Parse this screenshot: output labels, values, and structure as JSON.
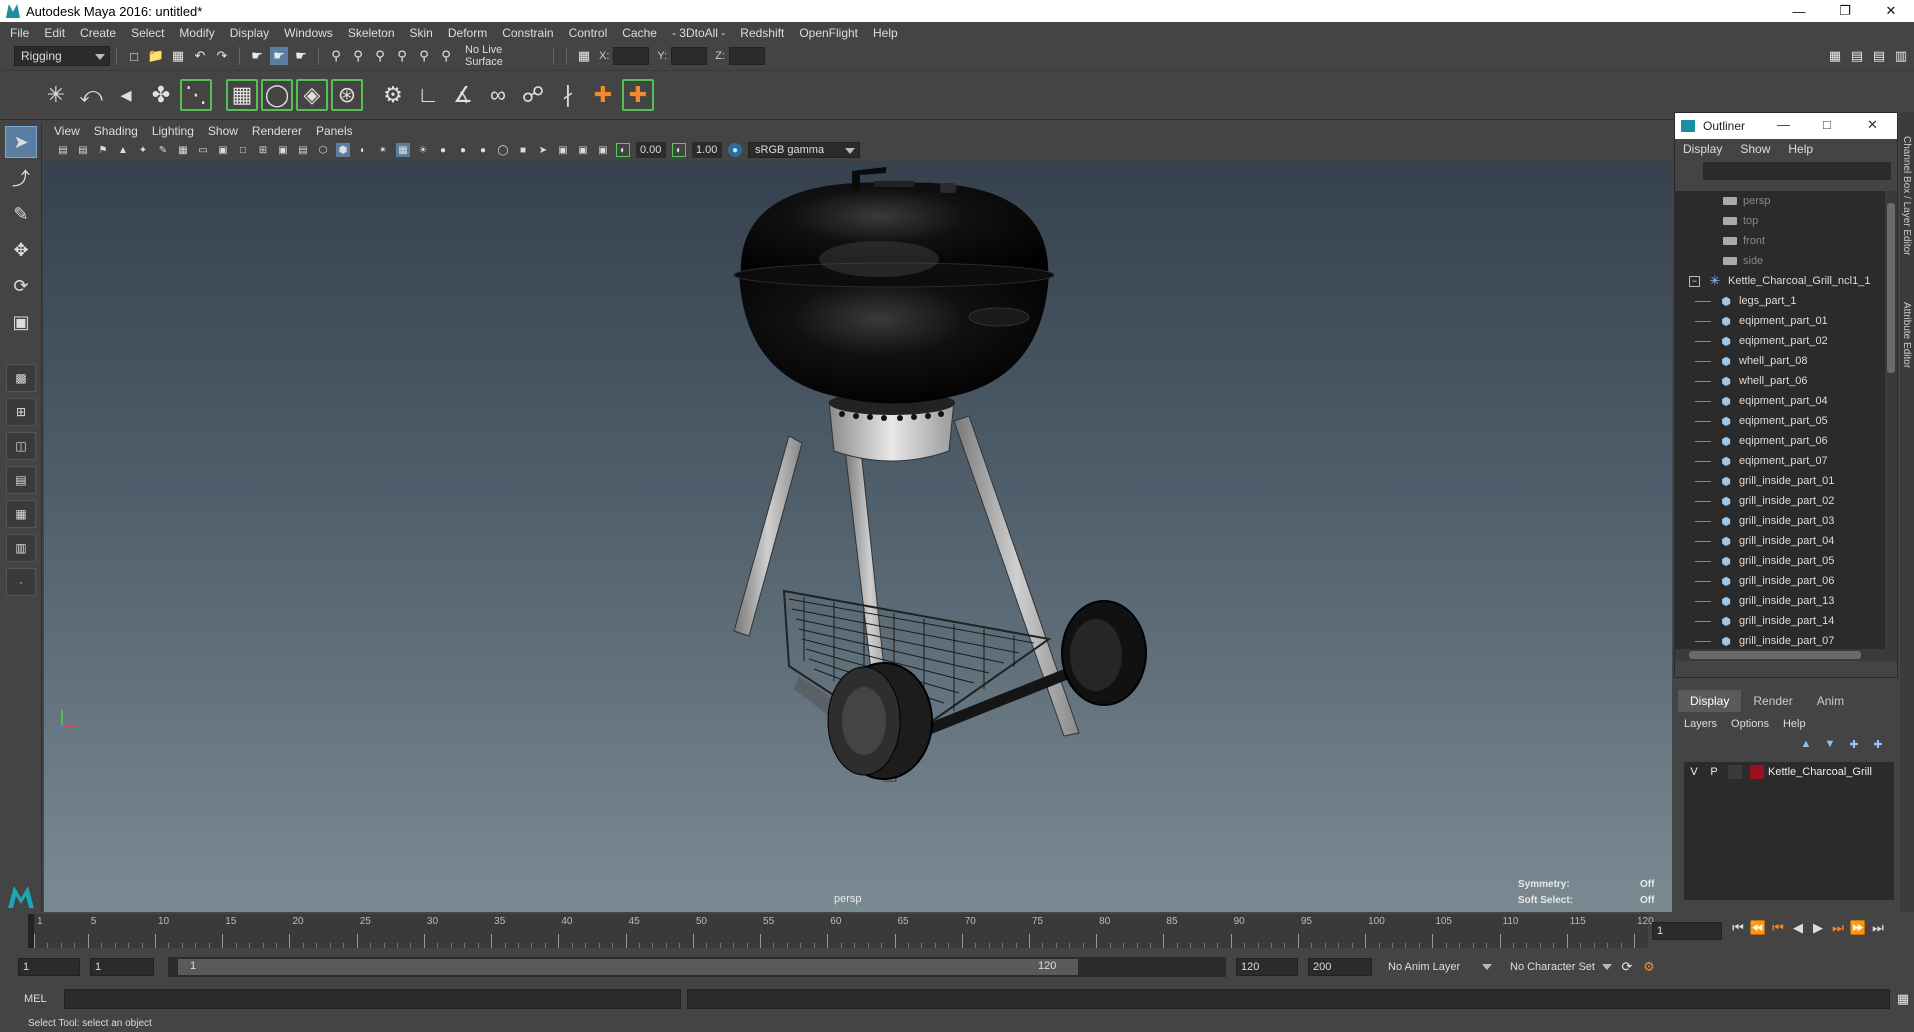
{
  "window": {
    "title": "Autodesk Maya 2016: untitled*"
  },
  "menubar": [
    "File",
    "Edit",
    "Create",
    "Select",
    "Modify",
    "Display",
    "Windows",
    "Skeleton",
    "Skin",
    "Deform",
    "Constrain",
    "Control",
    "Cache",
    "- 3DtoAll -",
    "Redshift",
    "OpenFlight",
    "Help"
  ],
  "statusline": {
    "menuset": "Rigging",
    "live_surface": "No Live Surface",
    "x_label": "X:",
    "y_label": "Y:",
    "z_label": "Z:"
  },
  "viewport": {
    "menu": [
      "View",
      "Shading",
      "Lighting",
      "Show",
      "Renderer",
      "Panels"
    ],
    "exposure": "0.00",
    "gamma": "1.00",
    "colorspace": "sRGB gamma",
    "camera": "persp",
    "hud": {
      "symmetry_label": "Symmetry:",
      "symmetry_value": "Off",
      "softselect_label": "Soft Select:",
      "softselect_value": "Off"
    }
  },
  "outliner": {
    "title": "Outliner",
    "menu": [
      "Display",
      "Show",
      "Help"
    ],
    "cameras": [
      "persp",
      "top",
      "front",
      "side"
    ],
    "root": "Kettle_Charcoal_Grill_ncl1_1",
    "children": [
      "legs_part_1",
      "eqipment_part_01",
      "eqipment_part_02",
      "whell_part_08",
      "whell_part_06",
      "eqipment_part_04",
      "eqipment_part_05",
      "eqipment_part_06",
      "eqipment_part_07",
      "grill_inside_part_01",
      "grill_inside_part_02",
      "grill_inside_part_03",
      "grill_inside_part_04",
      "grill_inside_part_05",
      "grill_inside_part_06",
      "grill_inside_part_13",
      "grill_inside_part_14",
      "grill_inside_part_07"
    ]
  },
  "layer_editor": {
    "tabs": [
      "Display",
      "Render",
      "Anim"
    ],
    "menu": [
      "Layers",
      "Options",
      "Help"
    ],
    "layers": [
      {
        "v": "V",
        "p": "P",
        "name": "Kettle_Charcoal_Grill",
        "color": "#9b1020"
      }
    ]
  },
  "side_tabs": [
    "Channel Box / Layer Editor",
    "Attribute Editor"
  ],
  "timeline": {
    "ticks": [
      1,
      5,
      10,
      15,
      20,
      25,
      30,
      35,
      40,
      45,
      50,
      55,
      60,
      65,
      70,
      75,
      80,
      85,
      90,
      95,
      100,
      105,
      110,
      115,
      120
    ],
    "current_frame": "1",
    "range_start": "1",
    "playback_start": "1",
    "slider_start": "1",
    "slider_end": "120",
    "playback_end": "120",
    "range_end": "200",
    "anim_layer": "No Anim Layer",
    "character_set": "No Character Set"
  },
  "cmdline": {
    "label": "MEL"
  },
  "helpline": "Select Tool: select an object"
}
